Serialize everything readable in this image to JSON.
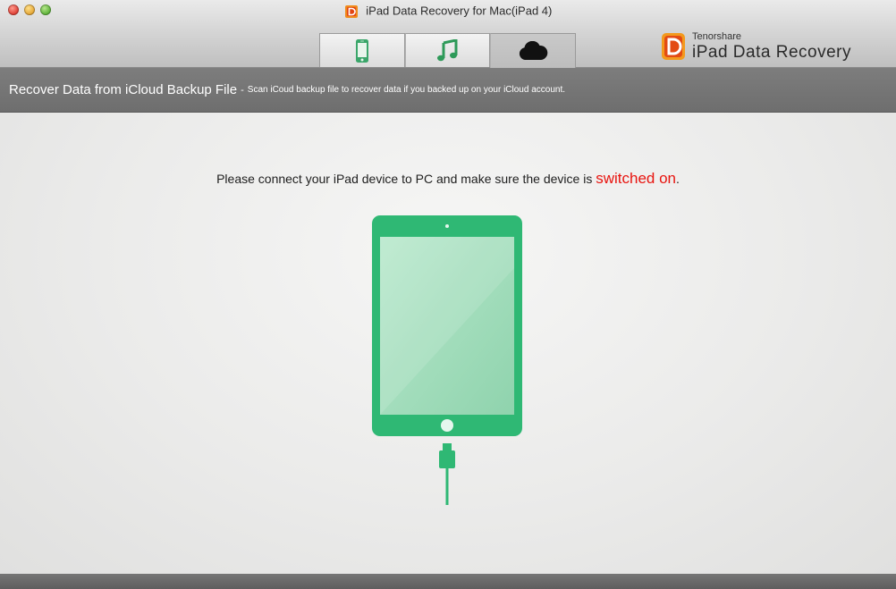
{
  "window": {
    "title": "iPad Data Recovery for Mac(iPad 4)"
  },
  "tabs": [
    {
      "icon": "device-icon",
      "active": false
    },
    {
      "icon": "music-icon",
      "active": false
    },
    {
      "icon": "cloud-icon",
      "active": true
    }
  ],
  "brand": {
    "company": "Tenorshare",
    "product": "iPad Data Recovery",
    "logo_letter": "D"
  },
  "header": {
    "title": "Recover Data from iCloud Backup File",
    "separator": "-",
    "description": "Scan iCoud backup file to recover data if you backed up on your iCloud account."
  },
  "content": {
    "message_prefix": "Please connect your iPad device to PC and make sure the device is ",
    "message_highlight": "switched on",
    "message_suffix": "."
  },
  "colors": {
    "accent_green": "#2fb874",
    "highlight_red": "#e8140f",
    "header_bg": "#757575"
  }
}
